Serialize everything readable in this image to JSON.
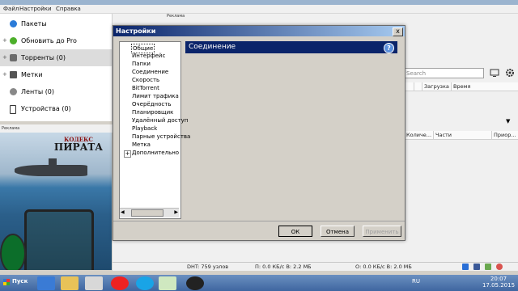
{
  "app": {
    "menu": [
      "Файл",
      "Настройки",
      "Справка"
    ],
    "colors": {
      "accent": "#0a246a",
      "dialog_bg": "#d4d0c8",
      "taskbar": "#3f66a0"
    }
  },
  "sidebar": {
    "items": [
      {
        "label": "Пакеты",
        "icon": "bundle-icon",
        "expander": ""
      },
      {
        "label": "Обновить до Pro",
        "icon": "upgrade-icon",
        "expander": "+"
      },
      {
        "label": "Торренты (0)",
        "icon": "torrents-icon",
        "expander": "+"
      },
      {
        "label": "Метки",
        "icon": "label-icon",
        "expander": "+"
      },
      {
        "label": "Ленты (0)",
        "icon": "feeds-icon",
        "expander": ""
      },
      {
        "label": "Устройства (0)",
        "icon": "devices-icon",
        "expander": ""
      }
    ]
  },
  "ads": {
    "label_left": "Реклама",
    "label_top": "Реклама",
    "brand_line1": "КОДЕКС",
    "brand_line2": "ПИРАТА"
  },
  "main": {
    "search_placeholder": "Search",
    "columns_top": [
      "Загрузка",
      "Время"
    ],
    "columns_bottom": [
      "Количе...",
      "Части",
      "Приор..."
    ]
  },
  "status": {
    "dht": "DHT: 759 узлов",
    "down": "П: 0.0 КБ/с В: 2.2 МБ",
    "up": "О: 0.0 КБ/с В: 2.0 МБ"
  },
  "taskbar": {
    "start": "Пуск",
    "lang": "RU",
    "time": "20:07",
    "date": "17.05.2015"
  },
  "dialog": {
    "title": "Настройки",
    "close": "x",
    "panel_title": "Соединение",
    "tree": [
      "Общие",
      "Интерфейс",
      "Папки",
      "Соединение",
      "Скорость",
      "BitTorrent",
      "Лимит трафика",
      "Очерёдность",
      "Планировщик",
      "Удалённый доступ",
      "Playback",
      "Парные устройства",
      "Метка",
      "Дополнительно"
    ],
    "buttons": {
      "ok": "ОК",
      "cancel": "Отмена",
      "apply": "Применить"
    }
  }
}
